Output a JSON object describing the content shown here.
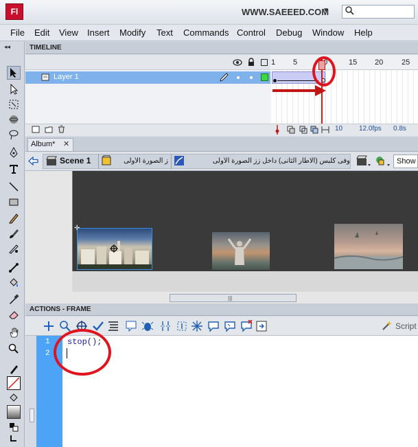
{
  "titlebar": {
    "app_logo": "Fl",
    "site": "WWW.SAEEED.COM"
  },
  "menu": [
    "File",
    "Edit",
    "View",
    "Insert",
    "Modify",
    "Text",
    "Commands",
    "Control",
    "Debug",
    "Window",
    "Help"
  ],
  "timeline": {
    "panel_title": "TIMELINE",
    "layer_name": "Layer 1",
    "frame_numbers": [
      "1",
      "5",
      "10",
      "15",
      "20",
      "25"
    ],
    "current_frame": "10",
    "fps": "12.0fps",
    "elapsed": "0.8s"
  },
  "document": {
    "tab": "Album*",
    "scene": "Scene 1",
    "breadcrumb_1": "ز الصورة الأولى",
    "breadcrumb_2": "وفى كلبس (الاطار الثانى) داخل زز الصورة الأولى",
    "show_label": "Show"
  },
  "actions": {
    "panel_title": "ACTIONS - FRAME",
    "script_assist": "Script",
    "lines": [
      "1",
      "2"
    ],
    "code_line1": "stop();"
  },
  "colors": {
    "accent_red": "#e0141e",
    "gutter_blue": "#4da3f5",
    "layer_selected": "#7fb2ea"
  }
}
